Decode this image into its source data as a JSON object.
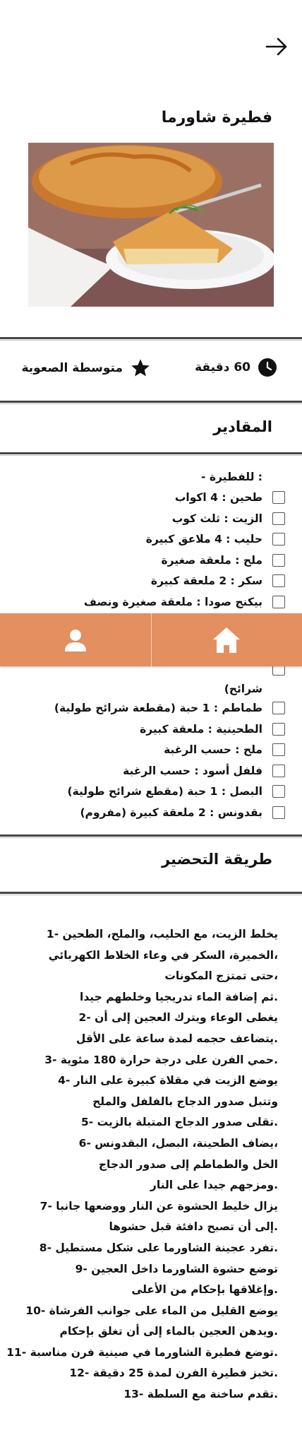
{
  "header": {
    "back_icon": "arrow-right-icon"
  },
  "recipe": {
    "title": "فطيرة شاورما",
    "image_alt": "فطيرة شاورما",
    "time": "60 دقيقة",
    "difficulty": "متوسطة الصعوبة"
  },
  "ingredients": {
    "title": "المقادير",
    "rows_top": [
      {
        "text": ": للفطيرة -",
        "checkbox": false
      },
      {
        "text": "طحين : 4 اكواب",
        "checkbox": true
      },
      {
        "text": "الزيت : ثلث كوب",
        "checkbox": true
      },
      {
        "text": "حليب : 4 ملاعق كبيرة",
        "checkbox": true
      },
      {
        "text": "ملح : ملعقة صغيرة",
        "checkbox": true
      },
      {
        "text": "سكر : 2 ملعقة كبيرة",
        "checkbox": true
      },
      {
        "text": "بيكنج صودا : ملعقة صغيرة ونصف",
        "checkbox": true
      }
    ],
    "wrapped_tail": "شرائح)",
    "rows_bottom": [
      {
        "text": "طماطم : 1 حبة (مقطعة شرائح طولية)",
        "checkbox": true
      },
      {
        "text": "الطحينية : ملعقة كبيرة",
        "checkbox": true
      },
      {
        "text": "ملح : حسب الرغبة",
        "checkbox": true
      },
      {
        "text": "فلفل أسود : حسب الرغبة",
        "checkbox": true
      },
      {
        "text": "البصل : 1 حبة (مقطع شرائح طولية)",
        "checkbox": true
      },
      {
        "text": "بقدونس : 2 ملعقة كبيرة (مفروم)",
        "checkbox": true
      }
    ]
  },
  "preparation": {
    "title": "طريقة التحضير",
    "lines": [
      "يخلط الزيت، مع الحليب، والملح، الطحين -1",
      "،الخميرة، السكر في وعاء الخلاط الكهربائي",
      "،حتى تمتزج المكونات",
      ".ثم إضافة الماء تدريجيا وخلطهم جيدا",
      "يغطى الوعاء ويترك العجين إلى أن -2",
      ".يتضاعف حجمه لمدة ساعة على الأقل",
      ".حمي الفرن على درجة حرارة 180 مئوية -3",
      "يوضع الزيت في مقلاة كبيرة على النار -4",
      "وتتبل صدور الدجاج بالفلفل والملح",
      ".تقلى صدور الدجاج المتبلة بالزيت -5",
      "،يضاف الطحينة، البصل، البقدونس -6",
      "الخل والطماطم إلى صدور الدجاج",
      ".ومزجهم جيدا على النار",
      "يزال خليط الحشوة عن النار ووضعها جانبا -7",
      ".إلى أن تصبح دافئة قبل حشوها",
      ".تفرد عجينة الشاورما على شكل مستطيل -8",
      "توضع حشوة الشاورما داخل العجين -9",
      ".وإغلاقها بإحكام من الأعلى",
      "يوضع القليل من الماء على جوانب الفرشاة -10",
      ".ويدهن العجين بالماء إلى أن تغلق بإحكام",
      ".توضع فطيرة الشاورما في صينية فرن مناسبة -11",
      ".تخبز فطيرة الفرن لمدة 25 دقيقة -12",
      ".تقدم ساخنة مع السلطة -13"
    ]
  },
  "nav": {
    "home_icon": "home-icon",
    "profile_icon": "user-icon"
  },
  "colors": {
    "nav_bg": "#e38f5f",
    "text": "#111111"
  }
}
